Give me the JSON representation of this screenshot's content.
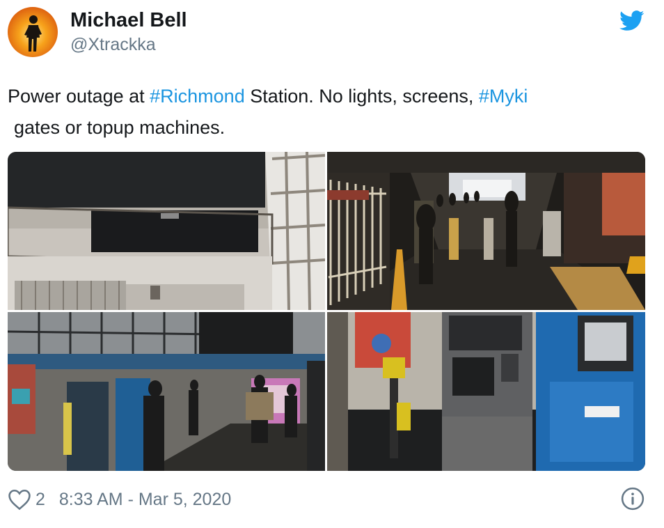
{
  "author": {
    "name": "Michael Bell",
    "handle": "@Xtrackka"
  },
  "tweet": {
    "part1": "Power outage at ",
    "tag1": "#Richmond",
    "part2": " Station. No lights, screens, ",
    "tag2": "#Myki",
    "line2": "gates or topup machines."
  },
  "media": {
    "photos": [
      {
        "icon": "station-canopy-photo"
      },
      {
        "icon": "dark-concourse-gates-photo"
      },
      {
        "icon": "dark-platform-passengers-photo"
      },
      {
        "icon": "myki-machines-photo"
      }
    ]
  },
  "footer": {
    "likes": "2",
    "timestamp": "8:33 AM - Mar 5, 2020"
  },
  "icons": {
    "brand": "twitter-bird-icon",
    "like": "heart-icon",
    "info": "info-icon"
  },
  "colors": {
    "brand": "#1da1f2",
    "hashtag": "#1b95e0",
    "muted": "#657786",
    "text": "#14171a"
  }
}
